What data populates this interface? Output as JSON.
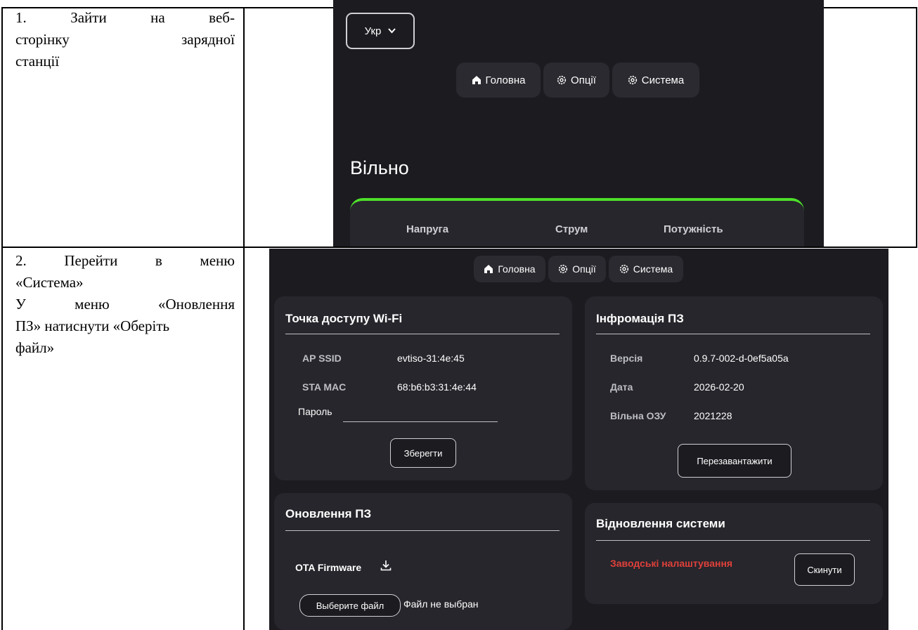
{
  "steps": [
    {
      "text_lines": [
        "1.",
        "Зайти",
        "на",
        "веб-",
        "сторінку",
        "зарядної",
        "станції"
      ]
    },
    {
      "text_lines": [
        "2.",
        "Перейти",
        "в",
        "меню",
        "«Система»",
        "У",
        "меню",
        "«Оновлення",
        "ПЗ» натиснути «Оберіть",
        "файл»"
      ]
    }
  ],
  "shot1": {
    "lang": "Укр",
    "nav": [
      "Головна",
      "Опції",
      "Система"
    ],
    "status": "Вільно",
    "metrics": [
      "Напруга",
      "Струм",
      "Потужність"
    ]
  },
  "shot2": {
    "nav": [
      "Головна",
      "Опції",
      "Система"
    ],
    "wifi": {
      "title": "Точка доступу Wi-Fi",
      "ap_label": "AP SSID",
      "ap_value": "evtiso-31:4e:45",
      "mac_label": "STA MAC",
      "mac_value": "68:b6:b3:31:4e:44",
      "pass_label": "Пароль",
      "save": "Зберегти"
    },
    "info": {
      "title": "Інфромація ПЗ",
      "ver_label": "Версія",
      "ver_value": "0.9.7-002-d-0ef5a05a",
      "date_label": "Дата",
      "date_value": "2026-02-20",
      "ram_label": "Вільна ОЗУ",
      "ram_value": "2021228",
      "reboot": "Перезавантажити"
    },
    "update": {
      "title": "Оновлення ПЗ",
      "ota": "OTA Firmware",
      "choose": "Выберите файл",
      "no_file": "Файл не выбран"
    },
    "restore": {
      "title": "Відновлення системи",
      "factory": "Заводські налаштування",
      "reset": "Скинути",
      "factory_color": "#e0403a"
    },
    "accent_green": "#4ee02a"
  }
}
